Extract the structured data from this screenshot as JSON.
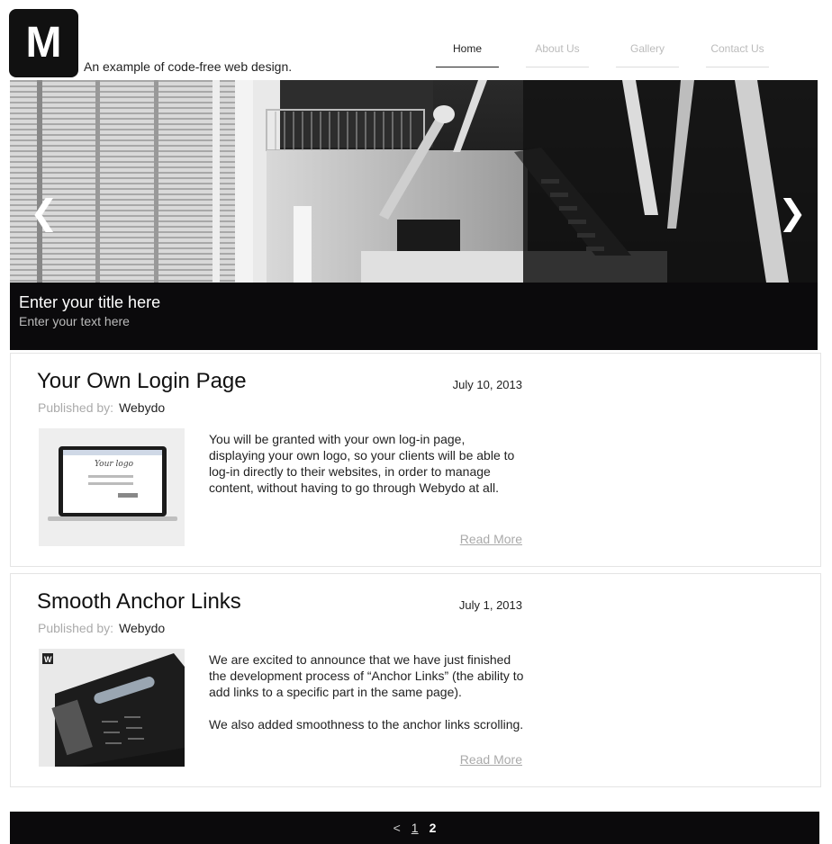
{
  "header": {
    "logo_letter": "M",
    "tagline": "An example of code-free web design."
  },
  "nav": {
    "items": [
      {
        "label": "Home",
        "active": true
      },
      {
        "label": "About Us",
        "active": false
      },
      {
        "label": "Gallery",
        "active": false
      },
      {
        "label": "Contact Us",
        "active": false
      }
    ]
  },
  "slider": {
    "title": "Enter your title here",
    "text": "Enter your text here",
    "prev_icon": "chevron-left-icon",
    "next_icon": "chevron-right-icon",
    "prev_glyph": "❮",
    "next_glyph": "❯"
  },
  "posts": [
    {
      "title": "Your Own Login Page",
      "date": "July 10, 2013",
      "published_label": "Published by:",
      "author": "Webydo",
      "thumb_text": "Your logo",
      "body": "You will be granted with your own log-in page, displaying your own logo, so your clients will be able to log-in directly to their websites, in order to manage content, without having to go through Webydo at all.",
      "read_more": "Read More"
    },
    {
      "title": "Smooth Anchor Links",
      "date": "July 1, 2013",
      "published_label": "Published by:",
      "author": "Webydo",
      "thumb_text": "W",
      "body": "We are excited to announce that we have just finished the development process of “Anchor Links” (the ability to add links to a specific part in the same page).",
      "body2": "We also added smoothness to the anchor links scrolling.",
      "read_more": "Read More"
    }
  ],
  "pagination": {
    "prev": "<",
    "pages": [
      "1",
      "2"
    ],
    "current": "2"
  },
  "colors": {
    "accent": "#111111",
    "caption_bg": "#0b0a0c",
    "muted": "#aaaaaa"
  }
}
